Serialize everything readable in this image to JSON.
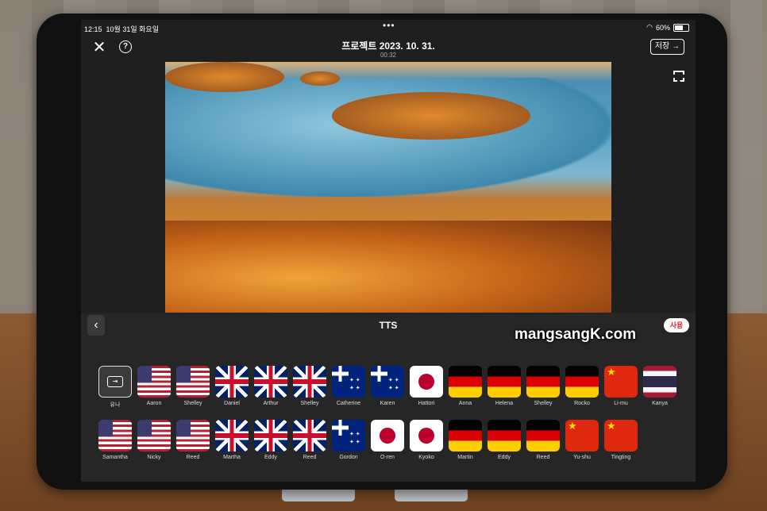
{
  "status": {
    "time": "12:15",
    "date": "10월 31일 화요일",
    "battery": "60%"
  },
  "header": {
    "title": "프로젝트 2023. 10. 31.",
    "duration": "00:32",
    "save_label": "저장 →",
    "help_label": "?"
  },
  "tts": {
    "title": "TTS",
    "use_label": "사용"
  },
  "watermark": "mangsangK.com",
  "voices_row1": [
    {
      "name": "유나",
      "flag": "yuna-icon"
    },
    {
      "name": "Aaron",
      "flag": "us-flag-icon"
    },
    {
      "name": "Shelley",
      "flag": "us-flag-icon"
    },
    {
      "name": "Daniel",
      "flag": "uk-flag-icon"
    },
    {
      "name": "Arthur",
      "flag": "uk-flag-icon"
    },
    {
      "name": "Shelley",
      "flag": "uk-flag-icon"
    },
    {
      "name": "Catherine",
      "flag": "au-flag-icon"
    },
    {
      "name": "Karen",
      "flag": "au-flag-icon"
    },
    {
      "name": "Hattori",
      "flag": "jp-flag-icon"
    },
    {
      "name": "Anna",
      "flag": "de-flag-icon"
    },
    {
      "name": "Helena",
      "flag": "de-flag-icon"
    },
    {
      "name": "Shelley",
      "flag": "de-flag-icon"
    },
    {
      "name": "Rocko",
      "flag": "de-flag-icon"
    },
    {
      "name": "Li-mu",
      "flag": "cn-flag-icon"
    },
    {
      "name": "Kanya",
      "flag": "th-flag-icon"
    }
  ],
  "voices_row2": [
    {
      "name": "Samantha",
      "flag": "us-flag-icon"
    },
    {
      "name": "Nicky",
      "flag": "us-flag-icon"
    },
    {
      "name": "Reed",
      "flag": "us-flag-icon"
    },
    {
      "name": "Martha",
      "flag": "uk-flag-icon"
    },
    {
      "name": "Eddy",
      "flag": "uk-flag-icon"
    },
    {
      "name": "Reed",
      "flag": "uk-flag-icon"
    },
    {
      "name": "Gordon",
      "flag": "au-flag-icon"
    },
    {
      "name": "O-ren",
      "flag": "jp-flag-icon"
    },
    {
      "name": "Kyoko",
      "flag": "jp-flag-icon"
    },
    {
      "name": "Martin",
      "flag": "de-flag-icon"
    },
    {
      "name": "Eddy",
      "flag": "de-flag-icon"
    },
    {
      "name": "Reed",
      "flag": "de-flag-icon"
    },
    {
      "name": "Yu-shu",
      "flag": "cn-flag-icon"
    },
    {
      "name": "Tingting",
      "flag": "cn-flag-icon"
    }
  ]
}
